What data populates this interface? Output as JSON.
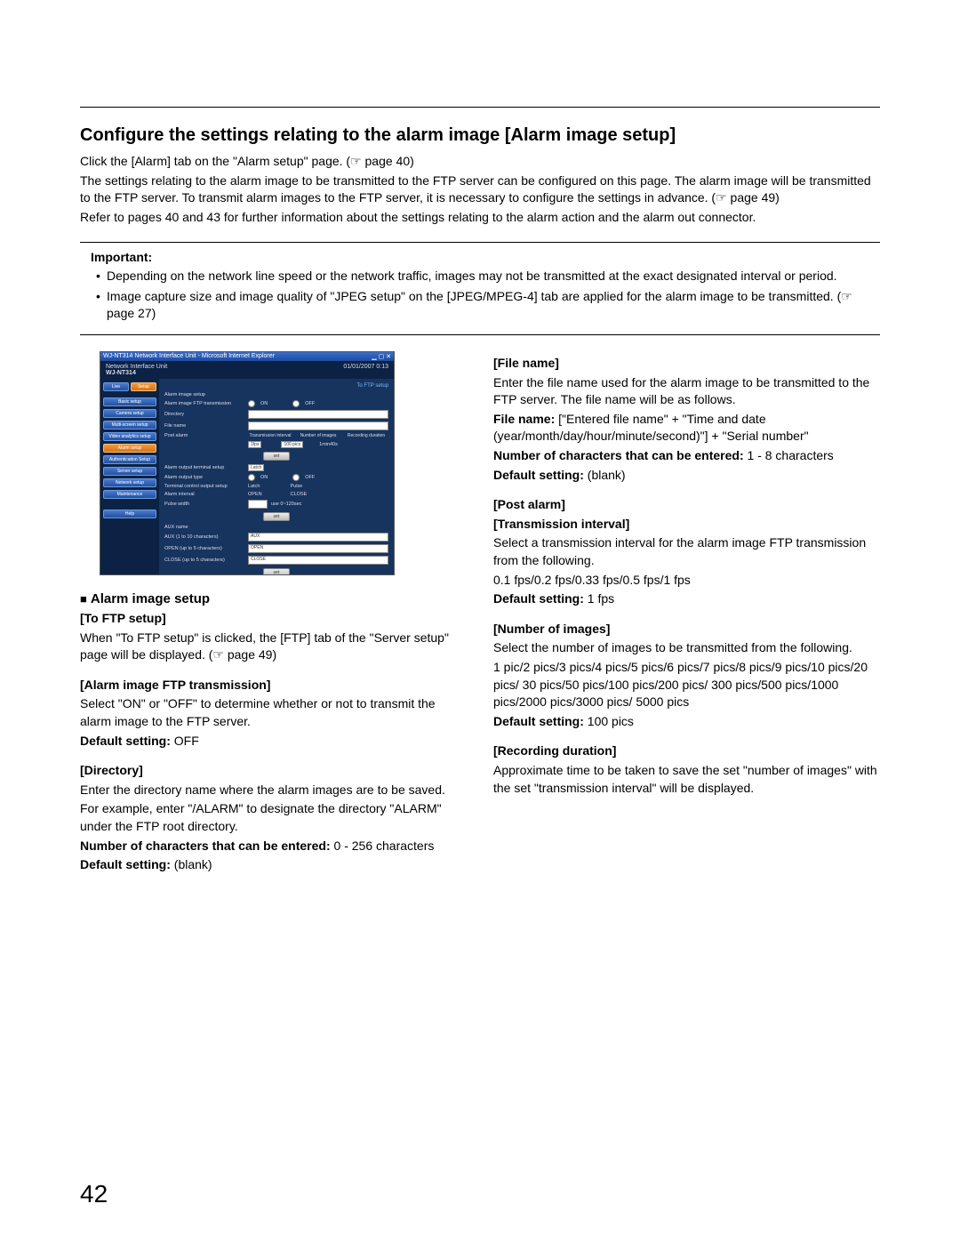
{
  "title": "Configure the settings relating to the alarm image [Alarm image setup]",
  "intro": {
    "l1": "Click the [Alarm] tab on the \"Alarm setup\" page. (☞ page 40)",
    "l2": "The settings relating to the alarm image to be transmitted to the FTP server can be configured on this page. The alarm image will be transmitted to the FTP server. To transmit alarm images to the FTP server, it is necessary to configure the settings in advance. (☞ page 49)",
    "l3": "Refer to pages 40 and 43 for further information about the settings relating to the alarm action and the alarm out connector."
  },
  "important": {
    "label": "Important:",
    "b1": "Depending on the network line speed or the network traffic, images may not be transmitted at the exact designated interval or period.",
    "b2": "Image capture size and image quality of \"JPEG setup\" on the [JPEG/MPEG-4] tab are applied for the alarm image to be transmitted. (☞ page 27)"
  },
  "screenshot": {
    "titlebar": "WJ-NT314 Network Interface Unit - Microsoft Internet Explorer",
    "model_left": "Network Interface Unit",
    "model": "WJ-NT314",
    "datetime": "01/01/2007 0:13",
    "tabs": {
      "live": "Live",
      "setup": "Setup"
    },
    "side": [
      "Basic setup",
      "Camera setup",
      "Multi-screen setup",
      "Video analytics setup",
      "Alarm setup",
      "Authentication Setup",
      "Server setup",
      "Network setup",
      "Maintenance",
      "Help"
    ],
    "link": "To FTP setup",
    "rows": {
      "heading": "Alarm image setup",
      "ftp": "Alarm image FTP transmission",
      "on": "ON",
      "off": "OFF",
      "dir": "Directory",
      "file": "File name",
      "post": "Post alarm",
      "ti": "Transmission interval",
      "ni": "Number of images",
      "rd": "Recording duration",
      "tival": "1fps",
      "nival": "100 pics",
      "rdval": "1min40s",
      "aux_h": "Alarm output terminal setup",
      "aux_sel": "Latch",
      "aot": "Alarm output type",
      "latch": "Latch",
      "pulse": "Pulse",
      "tos": "Terminal control output setup",
      "open": "OPEN",
      "close": "CLOSE",
      "aint": "Alarm interval",
      "pw": "Pulse width",
      "pwval": "use 0~120sec",
      "set": "set",
      "aux": "AUX name",
      "aux1": "AUX (1 to 10 characters)",
      "aux1v": "AUX",
      "openl": "OPEN (up to 5 characters)",
      "openv": "OPEN",
      "closel": "CLOSE (up to 5 characters)",
      "closev": "CLOSE"
    }
  },
  "left": {
    "section": "Alarm image setup",
    "ftp_title": "[To FTP setup]",
    "ftp_body": "When \"To FTP setup\" is clicked, the [FTP] tab of the \"Server setup\" page will be displayed. (☞ page 49)",
    "trans_title": "[Alarm image FTP transmission]",
    "trans_body": "Select \"ON\" or \"OFF\" to determine whether or not to transmit the alarm image to the FTP server.",
    "trans_def_label": "Default setting:",
    "trans_def": " OFF",
    "dir_title": "[Directory]",
    "dir_b1": "Enter the directory name where the alarm images are to be saved.",
    "dir_b2": "For example, enter \"/ALARM\" to designate the directory \"ALARM\" under the FTP root directory.",
    "dir_chars_label": "Number of characters that can be entered:",
    "dir_chars": " 0 - 256 characters",
    "dir_def_label": "Default setting:",
    "dir_def": " (blank)"
  },
  "right": {
    "file_title": "[File name]",
    "file_b1": "Enter the file name used for the alarm image to be transmitted to the FTP server. The file name will be as follows.",
    "file_fn_label": "File name:",
    "file_fn": " [\"Entered file name\" + \"Time and date (year/month/day/hour/minute/second)\"] + \"Serial number\"",
    "file_chars_label": "Number of characters that can be entered:",
    "file_chars": " 1 - 8 characters",
    "file_def_label": "Default setting:",
    "file_def": " (blank)",
    "post_title1": "[Post alarm]",
    "post_title2": "[Transmission interval]",
    "post_b1": "Select a transmission interval for the alarm image FTP transmission from the following.",
    "post_b2": "0.1 fps/0.2 fps/0.33 fps/0.5 fps/1 fps",
    "post_def_label": "Default setting:",
    "post_def": " 1 fps",
    "num_title": "[Number of images]",
    "num_b1": "Select the number of images to be transmitted from the following.",
    "num_b2": "1 pic/2 pics/3 pics/4 pics/5 pics/6 pics/7 pics/8 pics/9 pics/10 pics/20 pics/ 30 pics/50 pics/100 pics/200 pics/ 300 pics/500 pics/1000 pics/2000 pics/3000 pics/ 5000 pics",
    "num_def_label": "Default setting:",
    "num_def": " 100 pics",
    "rec_title": "[Recording duration]",
    "rec_b1": "Approximate time to be taken to save the set \"number of images\" with the set \"transmission interval\" will be displayed."
  },
  "page_number": "42"
}
